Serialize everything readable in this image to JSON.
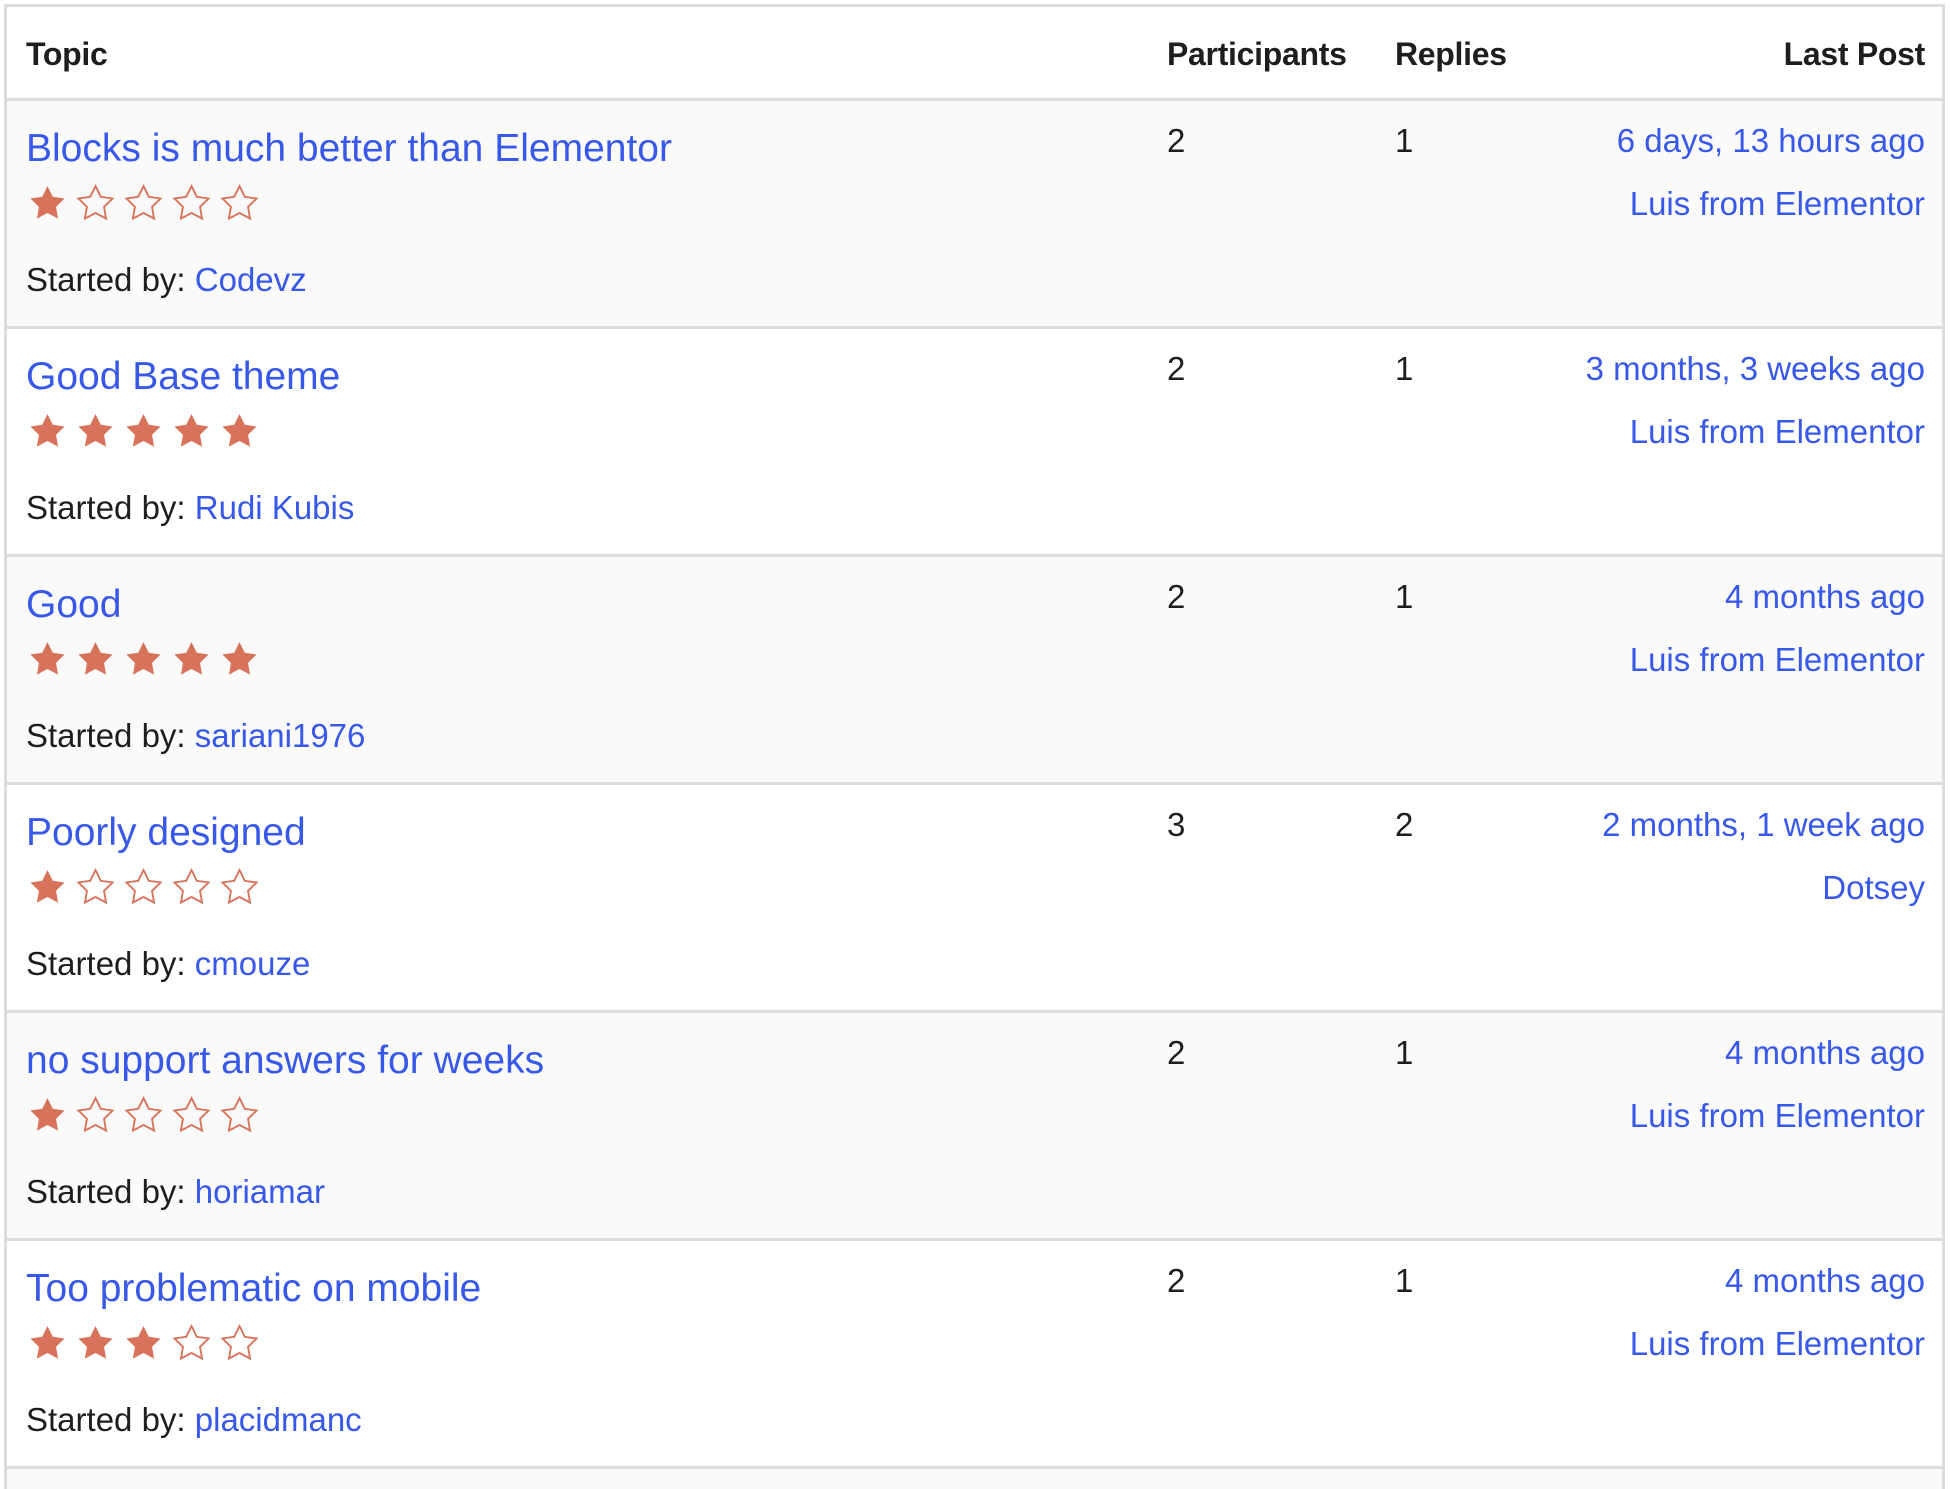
{
  "table": {
    "headers": {
      "topic": "Topic",
      "participants": "Participants",
      "replies": "Replies",
      "last_post": "Last Post"
    },
    "started_by_label": "Started by:",
    "colors": {
      "link": "#3858e9",
      "star": "#d6735a",
      "border": "#dcdcdc",
      "row_alt_bg": "#fafafa"
    },
    "rows": [
      {
        "title": "Blocks is much better than Elementor",
        "rating": 1,
        "rating_max": 5,
        "started_by": "Codevz",
        "participants": "2",
        "replies": "1",
        "last_post_time": "6 days, 13 hours ago",
        "last_post_author": "Luis from Elementor"
      },
      {
        "title": "Good Base theme",
        "rating": 5,
        "rating_max": 5,
        "started_by": "Rudi Kubis",
        "participants": "2",
        "replies": "1",
        "last_post_time": "3 months, 3 weeks ago",
        "last_post_author": "Luis from Elementor"
      },
      {
        "title": "Good",
        "rating": 5,
        "rating_max": 5,
        "started_by": "sariani1976",
        "participants": "2",
        "replies": "1",
        "last_post_time": "4 months ago",
        "last_post_author": "Luis from Elementor"
      },
      {
        "title": "Poorly designed",
        "rating": 1,
        "rating_max": 5,
        "started_by": "cmouze",
        "participants": "3",
        "replies": "2",
        "last_post_time": "2 months, 1 week ago",
        "last_post_author": "Dotsey"
      },
      {
        "title": "no support answers for weeks",
        "rating": 1,
        "rating_max": 5,
        "started_by": "horiamar",
        "participants": "2",
        "replies": "1",
        "last_post_time": "4 months ago",
        "last_post_author": "Luis from Elementor"
      },
      {
        "title": "Too problematic on mobile",
        "rating": 3,
        "rating_max": 5,
        "started_by": "placidmanc",
        "participants": "2",
        "replies": "1",
        "last_post_time": "4 months ago",
        "last_post_author": "Luis from Elementor"
      }
    ]
  }
}
